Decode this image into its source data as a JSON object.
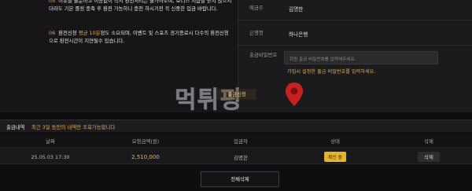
{
  "notices": [
    {
      "num": "05",
      "text": "이유를 불문하고 이용없이 즉시 환전처리는 불가하오며, 보너스 지급을 받지 않으시더라도 기본 롤링 충족 후 환전 가능하니 충전 하시기전 꼭 신중한 입금 바랍니다."
    },
    {
      "num": "06",
      "text_before": "환전신청 ",
      "highlight": "평균 10분",
      "text_after": "정도 소요되며, 이벤트 및 스포츠 경기종료시 다수의 환전신청으로 환전시간이 지연될수 있습니다."
    }
  ],
  "form": {
    "depositor_label": "예금주",
    "depositor_value": "김명한",
    "bank_label": "은행명",
    "bank_value": "하나은행",
    "pwd_label": "출금비밀번호",
    "pwd_placeholder": "회원 출금 비밀번호를 입력해주세요.",
    "pwd_hint": "가입시 설정한 출금 비밀번호를 입력하세요."
  },
  "apply_button": "출금신청",
  "watermark": "먹튀핑",
  "history": {
    "title": "출금내역",
    "subtitle": "최근 3일 동안의 내역만 조회가능합니다",
    "columns": [
      "날짜",
      "요청금액(원)",
      "입금자",
      "상태",
      "삭제"
    ],
    "rows": [
      {
        "date": "25.05.03 17:30",
        "amount": "2,510,000",
        "depositor": "김명한",
        "status": "확인 중",
        "delete": "삭제"
      }
    ],
    "delete_all": "전체삭제"
  },
  "colors": {
    "accent": "#e6a94e",
    "badge": "#e7b32a",
    "background": "#0e0e10"
  }
}
